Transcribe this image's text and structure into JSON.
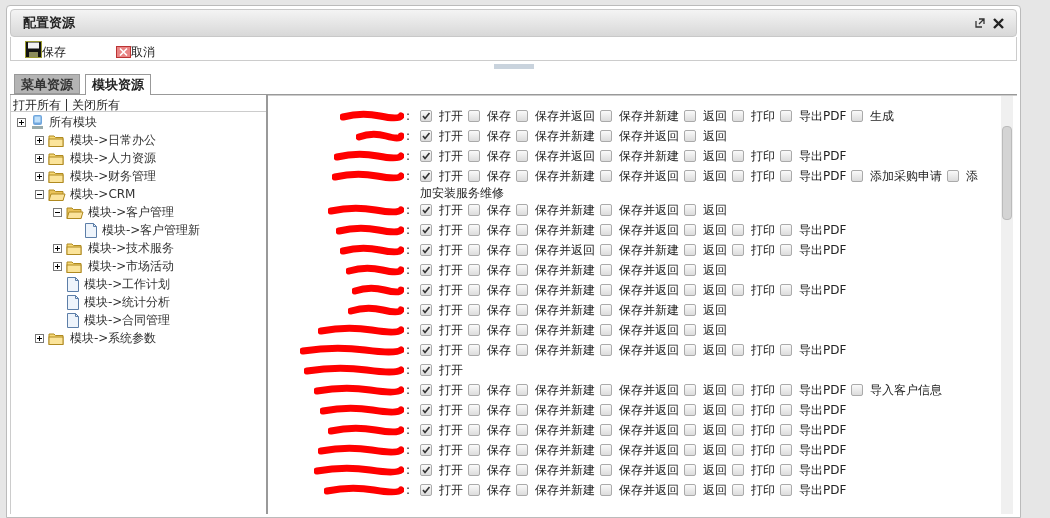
{
  "window": {
    "title": "配置资源"
  },
  "toolbar": [
    {
      "kind": "save",
      "label": "保存"
    },
    {
      "kind": "cancel",
      "label": "取消"
    }
  ],
  "tabs": [
    {
      "label": "菜单资源",
      "selected": false
    },
    {
      "label": "模块资源",
      "selected": true
    }
  ],
  "tree_actions": [
    "打开所有",
    "关闭所有"
  ],
  "tree": [
    {
      "label": "所有模块",
      "kind": "root",
      "expanded": false,
      "children": [
        {
          "label": "模块->日常办公",
          "kind": "folder",
          "expanded": false
        },
        {
          "label": "模块->人力资源",
          "kind": "folder",
          "expanded": false
        },
        {
          "label": "模块->财务管理",
          "kind": "folder",
          "expanded": false
        },
        {
          "label": "模块->CRM",
          "kind": "folder",
          "expanded": true,
          "children": [
            {
              "label": "模块->客户管理",
              "kind": "folder",
              "expanded": true,
              "children": [
                {
                  "label": "模块->客户管理新",
                  "kind": "file"
                }
              ]
            },
            {
              "label": "模块->技术服务",
              "kind": "folder",
              "expanded": false
            },
            {
              "label": "模块->市场活动",
              "kind": "folder",
              "expanded": false
            },
            {
              "label": "模块->工作计划",
              "kind": "file"
            },
            {
              "label": "模块->统计分析",
              "kind": "file"
            },
            {
              "label": "模块->合同管理",
              "kind": "file"
            }
          ]
        },
        {
          "label": "模块->系统参数",
          "kind": "folder",
          "expanded": false
        }
      ]
    }
  ],
  "rows": [
    {
      "label": ":",
      "options": [
        {
          "label": "打开",
          "checked": true
        },
        {
          "label": "保存",
          "checked": false
        },
        {
          "label": "保存并返回",
          "checked": false
        },
        {
          "label": "保存并新建",
          "checked": false
        },
        {
          "label": "返回",
          "checked": false
        },
        {
          "label": "打印",
          "checked": false
        },
        {
          "label": "导出PDF",
          "checked": false
        },
        {
          "label": "生成",
          "checked": false
        }
      ]
    },
    {
      "label": ":",
      "options": [
        {
          "label": "打开",
          "checked": true
        },
        {
          "label": "保存",
          "checked": false
        },
        {
          "label": "保存并新建",
          "checked": false
        },
        {
          "label": "保存并返回",
          "checked": false
        },
        {
          "label": "返回",
          "checked": false
        }
      ]
    },
    {
      "label": ":",
      "options": [
        {
          "label": "打开",
          "checked": true
        },
        {
          "label": "保存",
          "checked": false
        },
        {
          "label": "保存并返回",
          "checked": false
        },
        {
          "label": "保存并新建",
          "checked": false
        },
        {
          "label": "返回",
          "checked": false
        },
        {
          "label": "打印",
          "checked": false
        },
        {
          "label": "导出PDF",
          "checked": false
        }
      ]
    },
    {
      "label": ":",
      "options": [
        {
          "label": "打开",
          "checked": true
        },
        {
          "label": "保存",
          "checked": false
        },
        {
          "label": "保存并新建",
          "checked": false
        },
        {
          "label": "保存并返回",
          "checked": false
        },
        {
          "label": "返回",
          "checked": false
        },
        {
          "label": "打印",
          "checked": false
        },
        {
          "label": "导出PDF",
          "checked": false
        },
        {
          "label": "添加采购申请",
          "checked": false
        },
        {
          "label": "添",
          "checked": false
        }
      ],
      "wrapped_text": "加安装服务维修"
    },
    {
      "label": ":",
      "options": [
        {
          "label": "打开",
          "checked": true
        },
        {
          "label": "保存",
          "checked": false
        },
        {
          "label": "保存并新建",
          "checked": false
        },
        {
          "label": "保存并返回",
          "checked": false
        },
        {
          "label": "返回",
          "checked": false
        }
      ]
    },
    {
      "label": ":",
      "options": [
        {
          "label": "打开",
          "checked": true
        },
        {
          "label": "保存",
          "checked": false
        },
        {
          "label": "保存并新建",
          "checked": false
        },
        {
          "label": "保存并返回",
          "checked": false
        },
        {
          "label": "返回",
          "checked": false
        },
        {
          "label": "打印",
          "checked": false
        },
        {
          "label": "导出PDF",
          "checked": false
        }
      ]
    },
    {
      "label": ":",
      "options": [
        {
          "label": "打开",
          "checked": true
        },
        {
          "label": "保存",
          "checked": false
        },
        {
          "label": "保存并返回",
          "checked": false
        },
        {
          "label": "保存并新建",
          "checked": false
        },
        {
          "label": "返回",
          "checked": false
        },
        {
          "label": "打印",
          "checked": false
        },
        {
          "label": "导出PDF",
          "checked": false
        }
      ]
    },
    {
      "label": ":",
      "options": [
        {
          "label": "打开",
          "checked": true
        },
        {
          "label": "保存",
          "checked": false
        },
        {
          "label": "保存并新建",
          "checked": false
        },
        {
          "label": "保存并返回",
          "checked": false
        },
        {
          "label": "返回",
          "checked": false
        }
      ]
    },
    {
      "label": ":",
      "options": [
        {
          "label": "打开",
          "checked": true
        },
        {
          "label": "保存",
          "checked": false
        },
        {
          "label": "保存并新建",
          "checked": false
        },
        {
          "label": "保存并返回",
          "checked": false
        },
        {
          "label": "返回",
          "checked": false
        },
        {
          "label": "打印",
          "checked": false
        },
        {
          "label": "导出PDF",
          "checked": false
        }
      ]
    },
    {
      "label": ":",
      "options": [
        {
          "label": "打开",
          "checked": true
        },
        {
          "label": "保存",
          "checked": false
        },
        {
          "label": "保存并新建",
          "checked": false
        },
        {
          "label": "保存并新建",
          "checked": false
        },
        {
          "label": "返回",
          "checked": false
        }
      ]
    },
    {
      "label": ":",
      "options": [
        {
          "label": "打开",
          "checked": true
        },
        {
          "label": "保存",
          "checked": false
        },
        {
          "label": "保存并新建",
          "checked": false
        },
        {
          "label": "保存并返回",
          "checked": false
        },
        {
          "label": "返回",
          "checked": false
        }
      ]
    },
    {
      "label": ":",
      "options": [
        {
          "label": "打开",
          "checked": true
        },
        {
          "label": "保存",
          "checked": false
        },
        {
          "label": "保存并新建",
          "checked": false
        },
        {
          "label": "保存并返回",
          "checked": false
        },
        {
          "label": "返回",
          "checked": false
        },
        {
          "label": "打印",
          "checked": false
        },
        {
          "label": "导出PDF",
          "checked": false
        }
      ]
    },
    {
      "label": ":",
      "options": [
        {
          "label": "打开",
          "checked": true
        }
      ]
    },
    {
      "label": ":",
      "options": [
        {
          "label": "打开",
          "checked": true
        },
        {
          "label": "保存",
          "checked": false
        },
        {
          "label": "保存并新建",
          "checked": false
        },
        {
          "label": "保存并返回",
          "checked": false
        },
        {
          "label": "返回",
          "checked": false
        },
        {
          "label": "打印",
          "checked": false
        },
        {
          "label": "导出PDF",
          "checked": false
        },
        {
          "label": "导入客户信息",
          "checked": false
        }
      ]
    },
    {
      "label": ":",
      "options": [
        {
          "label": "打开",
          "checked": true
        },
        {
          "label": "保存",
          "checked": false
        },
        {
          "label": "保存并新建",
          "checked": false
        },
        {
          "label": "保存并返回",
          "checked": false
        },
        {
          "label": "返回",
          "checked": false
        },
        {
          "label": "打印",
          "checked": false
        },
        {
          "label": "导出PDF",
          "checked": false
        }
      ]
    },
    {
      "label": ":",
      "options": [
        {
          "label": "打开",
          "checked": true
        },
        {
          "label": "保存",
          "checked": false
        },
        {
          "label": "保存并新建",
          "checked": false
        },
        {
          "label": "保存并返回",
          "checked": false
        },
        {
          "label": "返回",
          "checked": false
        },
        {
          "label": "打印",
          "checked": false
        },
        {
          "label": "导出PDF",
          "checked": false
        }
      ]
    },
    {
      "label": ":",
      "options": [
        {
          "label": "打开",
          "checked": true
        },
        {
          "label": "保存",
          "checked": false
        },
        {
          "label": "保存并新建",
          "checked": false
        },
        {
          "label": "保存并返回",
          "checked": false
        },
        {
          "label": "返回",
          "checked": false
        },
        {
          "label": "打印",
          "checked": false
        },
        {
          "label": "导出PDF",
          "checked": false
        }
      ]
    },
    {
      "label": ":",
      "options": [
        {
          "label": "打开",
          "checked": true
        },
        {
          "label": "保存",
          "checked": false
        },
        {
          "label": "保存并新建",
          "checked": false
        },
        {
          "label": "保存并返回",
          "checked": false
        },
        {
          "label": "返回",
          "checked": false
        },
        {
          "label": "打印",
          "checked": false
        },
        {
          "label": "导出PDF",
          "checked": false
        }
      ]
    },
    {
      "label": ":",
      "options": [
        {
          "label": "打开",
          "checked": true
        },
        {
          "label": "保存",
          "checked": false
        },
        {
          "label": "保存并新建",
          "checked": false
        },
        {
          "label": "保存并返回",
          "checked": false
        },
        {
          "label": "返回",
          "checked": false
        },
        {
          "label": "打印",
          "checked": false
        },
        {
          "label": "导出PDF",
          "checked": false
        }
      ]
    }
  ]
}
